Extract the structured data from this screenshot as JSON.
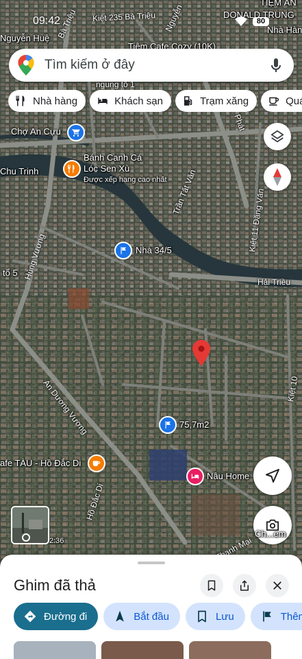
{
  "status_bar": {
    "time": "09:42",
    "battery": "80"
  },
  "search": {
    "placeholder": "Tìm kiếm ở đây"
  },
  "chips": [
    {
      "label": "Nhà hàng",
      "icon": "restaurant-icon"
    },
    {
      "label": "Khách sạn",
      "icon": "hotel-icon"
    },
    {
      "label": "Trạm xăng",
      "icon": "gas-station-icon"
    },
    {
      "label": "Quán cà",
      "icon": "coffee-icon"
    }
  ],
  "map": {
    "labels": {
      "tiem_an": "TIỆM ĂN",
      "donald_trung": "DONALD TRUNG",
      "nha_hang": "Nhà Hàng",
      "nguyen_hue": "Nguyễn Huệ",
      "tiem_cafe": "Tiệm Cafe Cozy (10K)",
      "kiet_235": "Kiệt 235 Bà Triệu",
      "ba_trieu": "Bà Triệu",
      "nguyen": "Nguyễn",
      "ngung_to": "ngung tổ 1",
      "phat": "Phát",
      "cho_an_cuu": "Chợ An Cựu",
      "banh_canh_1": "Bánh Canh Cá",
      "banh_canh_2": "Lóc Sen Xù",
      "banh_canh_rating": "Được xếp hạng cao nhất",
      "chu_trinh": "Chu Trinh",
      "tran_tat_van": "Trần Tất Văn",
      "kiet_11": "Kiệt 11 Đặng Văn",
      "hung_vuong": "Hùng Vương",
      "nha_34": "Nhà 34/5",
      "to_5": "tổ 5",
      "hai_trieu": "Hải Triều",
      "an_duong_vuong": "An Dương Vương",
      "kiet_10": "Kiệt 10",
      "area_75": "75,7m2",
      "cafe_tau": "afe TÀU - Hồ Đắc Di",
      "ho_dac_di": "Hồ Đắc Di",
      "nau_home": "Nâu Home",
      "thanh_mai": "Thanh Mại",
      "label_36": "2:36",
      "ch_em": "Ch...em"
    }
  },
  "sheet": {
    "title": "Ghim đã thả",
    "actions": [
      {
        "label": "Đường đi",
        "icon": "directions-icon"
      },
      {
        "label": "Bắt đầu",
        "icon": "navigation-icon"
      },
      {
        "label": "Lưu",
        "icon": "bookmark-icon"
      },
      {
        "label": "Thêm",
        "icon": "flag-icon"
      }
    ]
  },
  "colors": {
    "accent": "#1a6e8e",
    "pin_red": "#e53935",
    "river": "#27363d",
    "road": "#8a8c86",
    "marker_blue": "#1a73e8",
    "marker_orange": "#f57c00",
    "marker_pink": "#e91e63"
  }
}
